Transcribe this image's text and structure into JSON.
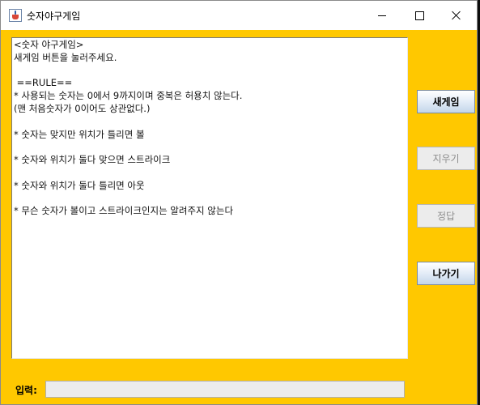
{
  "window": {
    "title": "숫자야구게임",
    "icon": "java-cup-icon",
    "background_color": "#ffc800"
  },
  "output": {
    "lines": [
      "<숫자 야구게임>",
      "새게임 버튼을 눌러주세요.",
      "",
      " ==RULE==",
      "* 사용되는 숫자는 0에서 9까지이며 중복은 허용치 않는다.",
      "(맨 처음숫자가 0이어도 상관없다.)",
      "",
      "* 숫자는 맞지만 위치가 틀리면 볼",
      "",
      "* 숫자와 위치가 둘다 맞으면 스트라이크",
      "",
      "* 숫자와 위치가 둘다 틀리면 아웃",
      "",
      "* 무슨 숫자가 볼이고 스트라이크인지는 알려주지 않는다"
    ]
  },
  "buttons": {
    "new_game": "새게임",
    "clear": "지우기",
    "answer": "정답",
    "exit": "나가기"
  },
  "input": {
    "label": "입력:",
    "value": ""
  }
}
